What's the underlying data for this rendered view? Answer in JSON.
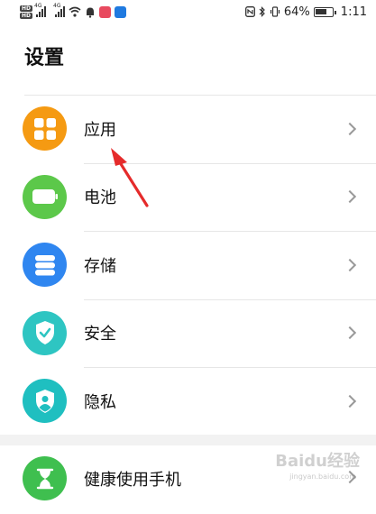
{
  "status_bar": {
    "hd1": "HD",
    "hd2": "HD",
    "signal1_type": "4G",
    "signal2_type": "4G",
    "battery_pct": "64%",
    "time": "1:11",
    "colors": {
      "app1": "#e84a5f",
      "app2": "#1f7ae0"
    }
  },
  "page": {
    "title": "设置"
  },
  "settings_items": [
    {
      "label": "应用",
      "icon": "apps-grid-icon",
      "color": "#f59a12"
    },
    {
      "label": "电池",
      "icon": "battery-icon",
      "color": "#5cc84a"
    },
    {
      "label": "存储",
      "icon": "storage-icon",
      "color": "#2f86f0"
    },
    {
      "label": "安全",
      "icon": "shield-check-icon",
      "color": "#2ec5c2"
    },
    {
      "label": "隐私",
      "icon": "privacy-shield-icon",
      "color": "#1fbfc0"
    }
  ],
  "partial_item": {
    "label": "健康使用手机",
    "icon": "hourglass-icon",
    "color": "#3fbf4f"
  },
  "annotation": {
    "arrow_color": "#e52b2b"
  },
  "watermark": {
    "text": "Baidu经验",
    "sub": "jingyan.baidu.com"
  }
}
